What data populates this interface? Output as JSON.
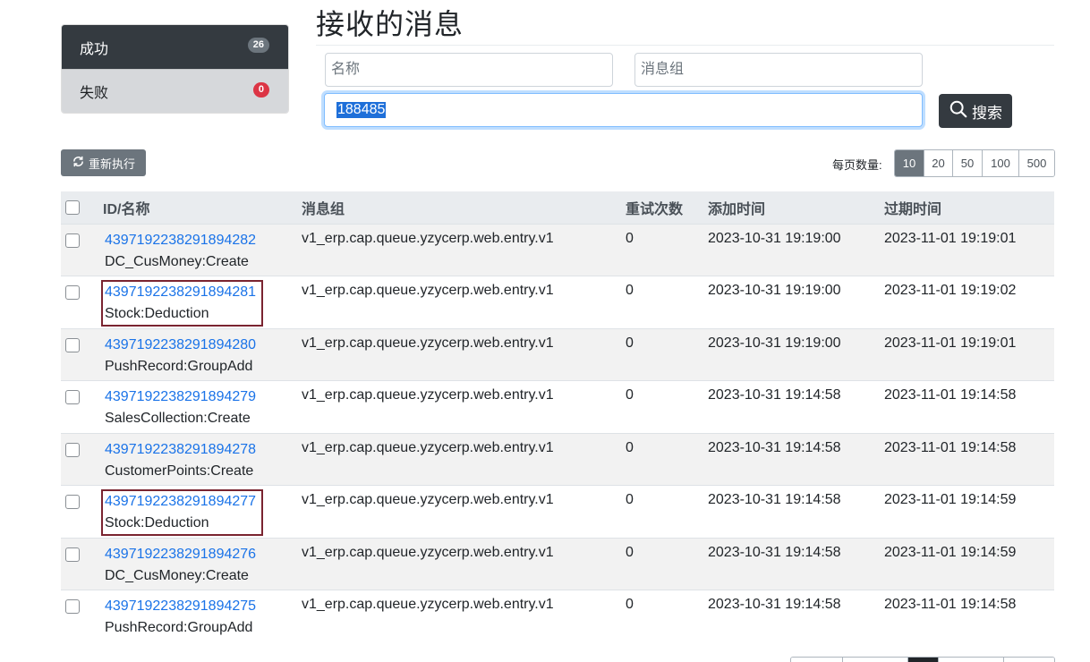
{
  "sidebar": {
    "items": [
      {
        "label": "成功",
        "count": "26",
        "active": true
      },
      {
        "label": "失败",
        "count": "0",
        "active": false
      }
    ]
  },
  "page": {
    "title": "接收的消息"
  },
  "filters": {
    "name_placeholder": "名称",
    "group_placeholder": "消息组",
    "content_value": "188485",
    "search_label": "搜索"
  },
  "toolbar": {
    "reexecute_label": "重新执行",
    "pagesize_label": "每页数量:",
    "pagesize_options": [
      "10",
      "20",
      "50",
      "100",
      "500"
    ],
    "pagesize_selected": "10"
  },
  "table": {
    "headers": {
      "id_name": "ID/名称",
      "group": "消息组",
      "retries": "重试次数",
      "added": "添加时间",
      "expires": "过期时间"
    },
    "rows": [
      {
        "id": "4397192238291894282",
        "name": "DC_CusMoney:Create",
        "group": "v1_erp.cap.queue.yzycerp.web.entry.v1",
        "retries": "0",
        "added": "2023-10-31 19:19:00",
        "expires": "2023-11-01 19:19:01"
      },
      {
        "id": "4397192238291894281",
        "name": "Stock:Deduction",
        "group": "v1_erp.cap.queue.yzycerp.web.entry.v1",
        "retries": "0",
        "added": "2023-10-31 19:19:00",
        "expires": "2023-11-01 19:19:02"
      },
      {
        "id": "4397192238291894280",
        "name": "PushRecord:GroupAdd",
        "group": "v1_erp.cap.queue.yzycerp.web.entry.v1",
        "retries": "0",
        "added": "2023-10-31 19:19:00",
        "expires": "2023-11-01 19:19:01"
      },
      {
        "id": "4397192238291894279",
        "name": "SalesCollection:Create",
        "group": "v1_erp.cap.queue.yzycerp.web.entry.v1",
        "retries": "0",
        "added": "2023-10-31 19:14:58",
        "expires": "2023-11-01 19:14:58"
      },
      {
        "id": "4397192238291894278",
        "name": "CustomerPoints:Create",
        "group": "v1_erp.cap.queue.yzycerp.web.entry.v1",
        "retries": "0",
        "added": "2023-10-31 19:14:58",
        "expires": "2023-11-01 19:14:58"
      },
      {
        "id": "4397192238291894277",
        "name": "Stock:Deduction",
        "group": "v1_erp.cap.queue.yzycerp.web.entry.v1",
        "retries": "0",
        "added": "2023-10-31 19:14:58",
        "expires": "2023-11-01 19:14:59"
      },
      {
        "id": "4397192238291894276",
        "name": "DC_CusMoney:Create",
        "group": "v1_erp.cap.queue.yzycerp.web.entry.v1",
        "retries": "0",
        "added": "2023-10-31 19:14:58",
        "expires": "2023-11-01 19:14:59"
      },
      {
        "id": "4397192238291894275",
        "name": "PushRecord:GroupAdd",
        "group": "v1_erp.cap.queue.yzycerp.web.entry.v1",
        "retries": "0",
        "added": "2023-10-31 19:14:58",
        "expires": "2023-11-01 19:14:58"
      }
    ]
  },
  "colors": {
    "primary_dark": "#343a40",
    "link": "#1a73e8",
    "badge_danger": "#dc3545",
    "highlight_border": "#7a2430"
  }
}
